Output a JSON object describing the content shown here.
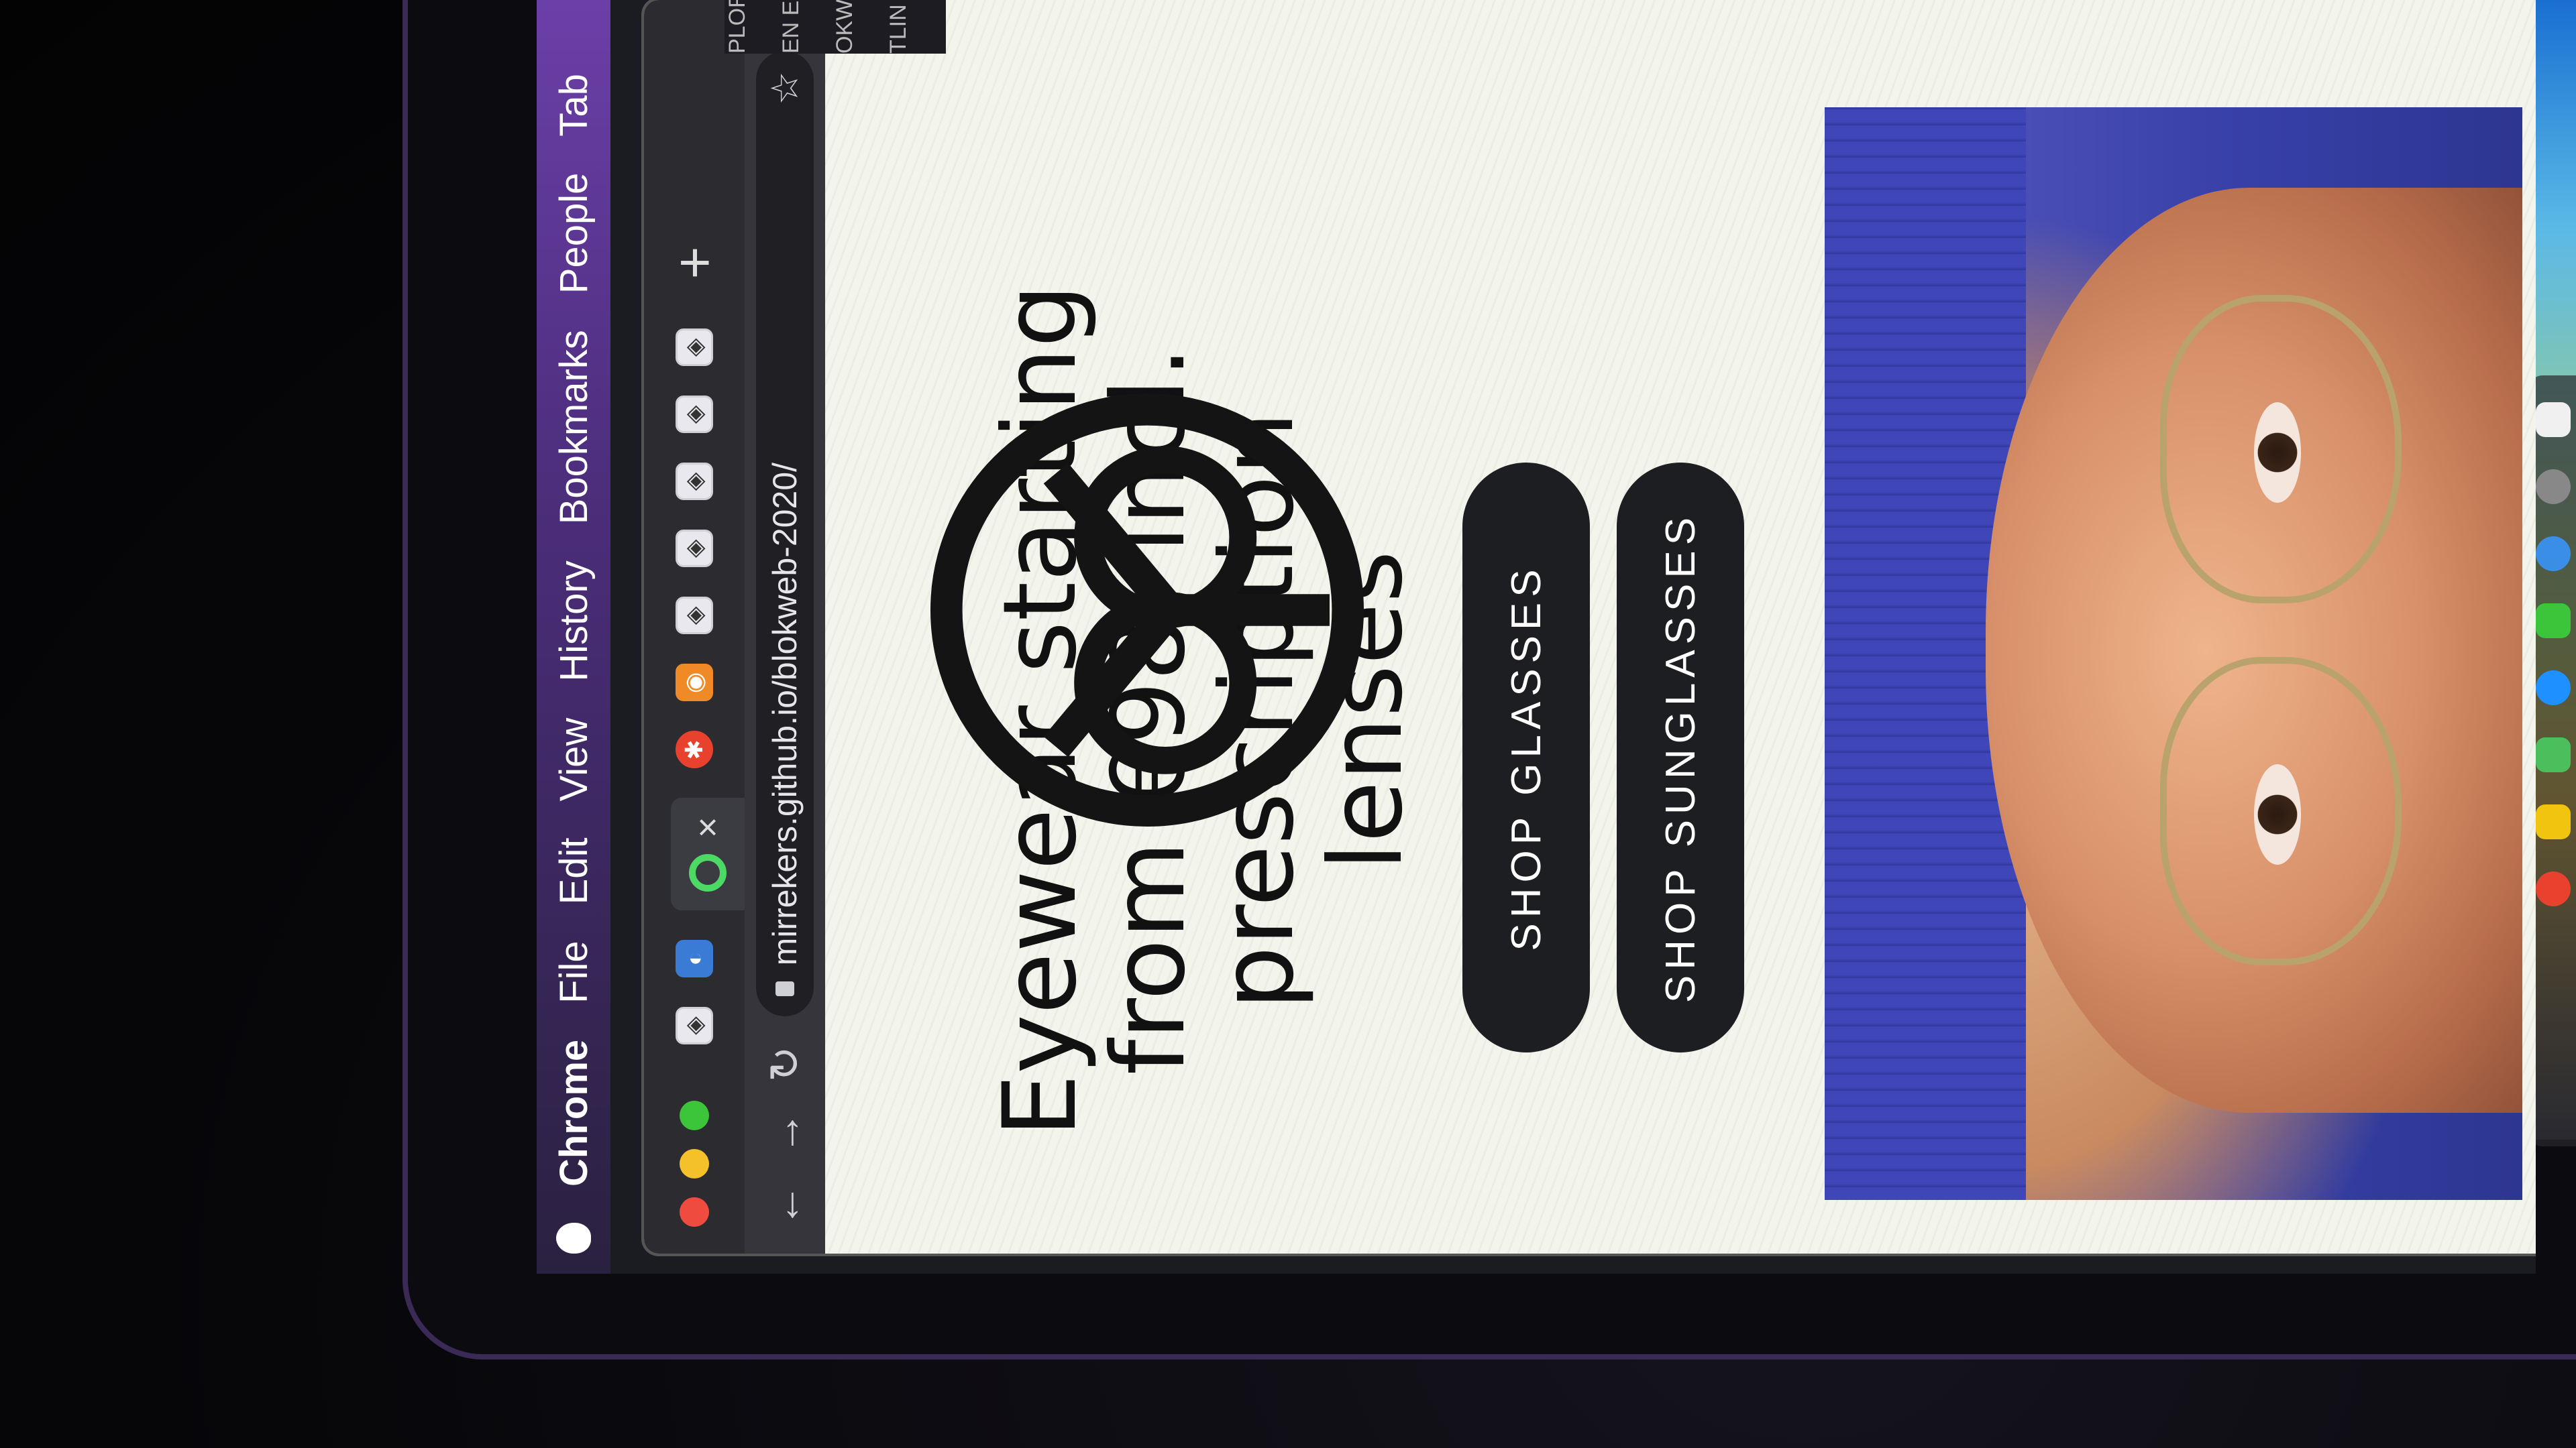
{
  "menubar": {
    "items": [
      "Chrome",
      "File",
      "Edit",
      "View",
      "History",
      "Bookmarks",
      "People",
      "Tab"
    ]
  },
  "tabs": {
    "close_glyph": "×",
    "new_tab_glyph": "+"
  },
  "address_bar": {
    "url": "mirrekers.github.io/blokweb-2020/"
  },
  "page": {
    "hero_text": "Eyewear starting from €98, incl. prescription lenses",
    "buttons": {
      "shop_glasses": "SHOP GLASSES",
      "shop_sunglasses": "SHOP SUNGLASSES"
    }
  },
  "background_sidebar": {
    "fragments": [
      "PLOR",
      "EN E",
      "OKW",
      "TLIN"
    ]
  },
  "colors": {
    "menubar_accent": "#4b2d7a",
    "button_bg": "#1d1e21",
    "beanie_blue": "#3f47b8",
    "traffic_red": "#ef4b3f",
    "traffic_yellow": "#f4c12b",
    "traffic_green": "#3cc43a"
  },
  "icons": [
    "apple-icon",
    "back-arrow-icon",
    "forward-arrow-icon",
    "reload-icon",
    "lock-icon",
    "bookmark-star-icon",
    "profile-avatar-icon",
    "more-menu-icon",
    "new-tab-icon",
    "tab-close-icon",
    "favicon-icons"
  ]
}
